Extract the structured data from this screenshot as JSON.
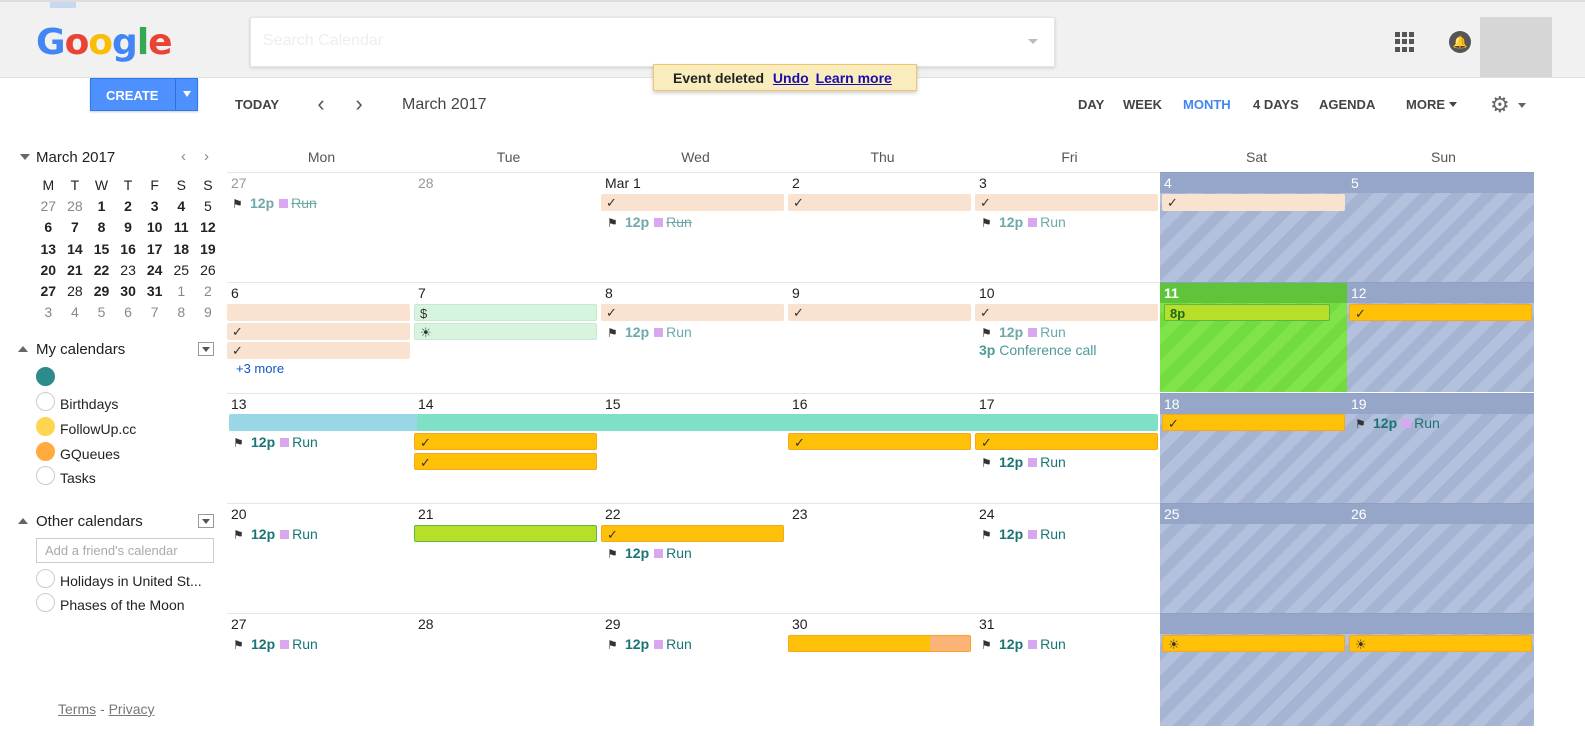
{
  "topbar": {
    "logo_letters": [
      "G",
      "o",
      "o",
      "g",
      "l",
      "e"
    ],
    "search_placeholder": "Search Calendar",
    "apps_icon": "apps-grid-icon",
    "bell_icon": "notification-bell-icon"
  },
  "toast": {
    "message": "Event deleted",
    "undo": "Undo",
    "learn_more": "Learn more"
  },
  "toolbar": {
    "create": "CREATE",
    "today": "TODAY",
    "period": "March 2017",
    "views": {
      "day": "DAY",
      "week": "WEEK",
      "month": "MONTH",
      "four_days": "4 DAYS",
      "agenda": "AGENDA",
      "more": "MORE"
    },
    "active_view": "MONTH"
  },
  "minical": {
    "title": "March 2017",
    "weekdays": [
      "M",
      "T",
      "W",
      "T",
      "F",
      "S",
      "S"
    ],
    "weeks": [
      [
        "27",
        "28",
        "1",
        "2",
        "3",
        "4",
        "5"
      ],
      [
        "6",
        "7",
        "8",
        "9",
        "10",
        "11",
        "12"
      ],
      [
        "13",
        "14",
        "15",
        "16",
        "17",
        "18",
        "19"
      ],
      [
        "20",
        "21",
        "22",
        "23",
        "24",
        "25",
        "26"
      ],
      [
        "27",
        "28",
        "29",
        "30",
        "31",
        "1",
        "2"
      ],
      [
        "3",
        "4",
        "5",
        "6",
        "7",
        "8",
        "9"
      ]
    ]
  },
  "my_calendars": {
    "title": "My calendars",
    "items": [
      {
        "name": "",
        "color": "#2e8b8b"
      },
      {
        "name": "Birthdays",
        "color": "#ffffff"
      },
      {
        "name": "FollowUp.cc",
        "color": "#ffd54f"
      },
      {
        "name": "GQueues",
        "color": "#ffab40"
      },
      {
        "name": "Tasks",
        "color": "#ffffff"
      }
    ]
  },
  "other_calendars": {
    "title": "Other calendars",
    "add_placeholder": "Add a friend's calendar",
    "items": [
      {
        "name": "Holidays in United St..."
      },
      {
        "name": "Phases of the Moon"
      }
    ]
  },
  "footer": {
    "terms": "Terms",
    "sep": "-",
    "privacy": "Privacy"
  },
  "month": {
    "weekdays": [
      "Mon",
      "Tue",
      "Wed",
      "Thu",
      "Fri",
      "Sat",
      "Sun"
    ],
    "rows": [
      [
        "27",
        "28",
        "Mar 1",
        "2",
        "3",
        "4",
        "5"
      ],
      [
        "6",
        "7",
        "8",
        "9",
        "10",
        "11",
        "12"
      ],
      [
        "13",
        "14",
        "15",
        "16",
        "17",
        "18",
        "19"
      ],
      [
        "20",
        "21",
        "22",
        "23",
        "24",
        "25",
        "26"
      ],
      [
        "27",
        "28",
        "29",
        "30",
        "31",
        "",
        ""
      ]
    ],
    "run_time": "12p",
    "run_name": "Run",
    "more_link": "+3 more",
    "conf_time": "3p",
    "conf_name": "Conference call",
    "sat11_time": "8p",
    "check": "✓",
    "dollar": "$",
    "sun_glyph": "☀"
  },
  "colors": {
    "accent": "#4285f4",
    "create": "#4d90fe",
    "teal_text": "#1a7474"
  }
}
